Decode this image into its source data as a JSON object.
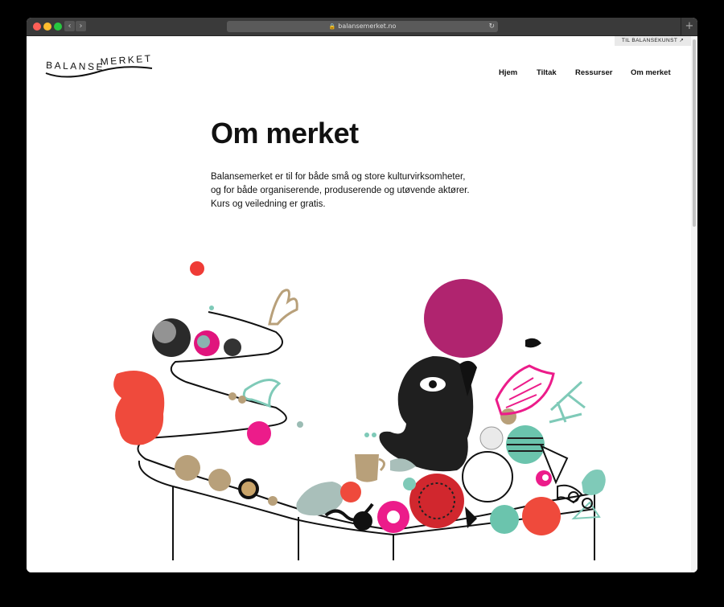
{
  "browser": {
    "url": "balansemerket.no",
    "back_icon": "chevron-left-icon",
    "forward_icon": "chevron-right-icon",
    "reload_icon": "reload-icon",
    "new_tab_icon": "plus-icon"
  },
  "header": {
    "external_link_label": "TIL BALANSEKUNST",
    "logo_text_left": "BALANSE",
    "logo_text_right": "MERKET"
  },
  "nav": {
    "items": [
      {
        "label": "Hjem"
      },
      {
        "label": "Tiltak"
      },
      {
        "label": "Ressurser"
      },
      {
        "label": "Om merket"
      }
    ]
  },
  "main": {
    "title": "Om merket",
    "intro_lines": [
      "Balansemerket er til for både små og store kulturvirksomheter,",
      "og for både organiserende, produserende og utøvende aktører.",
      "Kurs og veiledning er gratis."
    ]
  },
  "colors": {
    "accent_magenta": "#b0246f",
    "accent_red": "#ef4a3c",
    "accent_pink": "#ec1c8a",
    "accent_teal": "#7fcab8",
    "accent_tan": "#b8a07a",
    "ink": "#111111"
  }
}
